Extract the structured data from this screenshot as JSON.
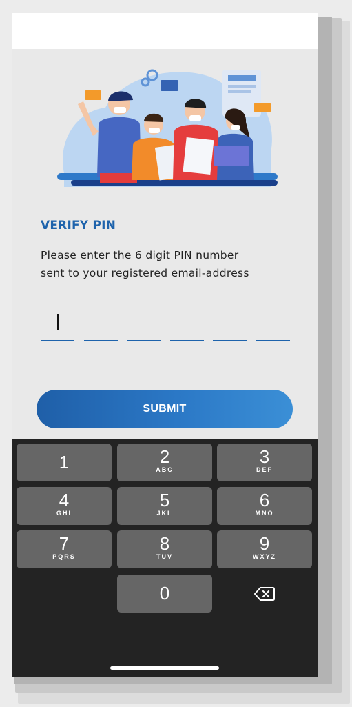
{
  "header": {
    "title": "VERIFY PIN",
    "subtitle_line1": "Please enter the 6 digit PIN number",
    "subtitle_line2": "sent to your registered email-address"
  },
  "pin": {
    "length": 6,
    "accent_color": "#1e63ac"
  },
  "submit": {
    "label": "SUBMIT"
  },
  "keyboard": {
    "keys": [
      {
        "num": "1",
        "letters": ""
      },
      {
        "num": "2",
        "letters": "ABC"
      },
      {
        "num": "3",
        "letters": "DEF"
      },
      {
        "num": "4",
        "letters": "GHI"
      },
      {
        "num": "5",
        "letters": "JKL"
      },
      {
        "num": "6",
        "letters": "MNO"
      },
      {
        "num": "7",
        "letters": "PQRS"
      },
      {
        "num": "8",
        "letters": "TUV"
      },
      {
        "num": "9",
        "letters": "WXYZ"
      },
      {
        "num": "0",
        "letters": ""
      }
    ],
    "backspace_icon": "backspace-icon"
  },
  "colors": {
    "accent": "#1e63ac",
    "keyboard_bg": "#232323",
    "key_bg": "#666666"
  }
}
